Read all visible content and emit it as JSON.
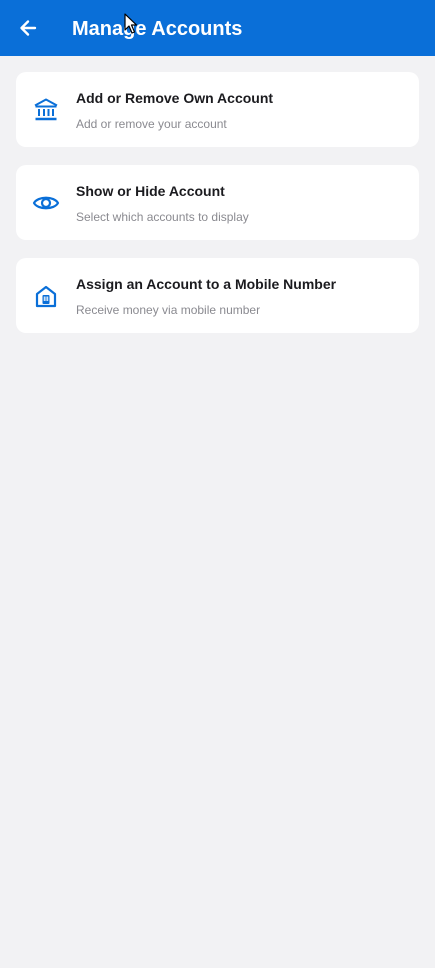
{
  "header": {
    "title": "Manage Accounts",
    "back_icon": "arrow-left-icon",
    "background_color": "#0a6fd8"
  },
  "items": [
    {
      "title": "Add or Remove Own Account",
      "subtitle": "Add or remove your account",
      "icon": "bank-icon"
    },
    {
      "title": "Show or Hide Account",
      "subtitle": "Select which accounts to display",
      "icon": "eye-icon"
    },
    {
      "title": "Assign an Account to a Mobile Number",
      "subtitle": "Receive money via mobile number",
      "icon": "mobile-home-icon"
    }
  ],
  "colors": {
    "accent": "#0a6fd8",
    "page_background": "#f2f2f4",
    "card_background": "#ffffff",
    "subtitle_text": "#8a8a90"
  }
}
